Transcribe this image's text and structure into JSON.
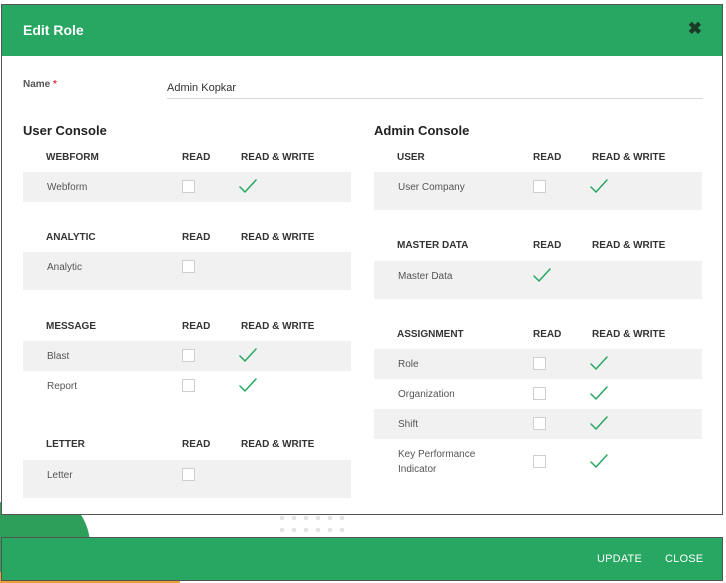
{
  "dialog": {
    "title": "Edit Role"
  },
  "name_field": {
    "label": "Name",
    "required_mark": "*",
    "value": "Admin Kopkar"
  },
  "user_console": {
    "title": "User Console",
    "sections": [
      {
        "header": "WEBFORM",
        "read_label": "READ",
        "rw_label": "READ & WRITE",
        "rows": [
          {
            "label": "Webform",
            "read": false,
            "rw": true
          }
        ]
      },
      {
        "header": "ANALYTIC",
        "read_label": "READ",
        "rw_label": "READ & WRITE",
        "rows": [
          {
            "label": "Analytic",
            "read": false,
            "rw": false
          }
        ]
      },
      {
        "header": "MESSAGE",
        "read_label": "READ",
        "rw_label": "READ & WRITE",
        "rows": [
          {
            "label": "Blast",
            "read": false,
            "rw": true
          },
          {
            "label": "Report",
            "read": false,
            "rw": true
          }
        ]
      },
      {
        "header": "LETTER",
        "read_label": "READ",
        "rw_label": "READ & WRITE",
        "rows": [
          {
            "label": "Letter",
            "read": false,
            "rw": false
          }
        ]
      }
    ]
  },
  "admin_console": {
    "title": "Admin Console",
    "sections": [
      {
        "header": "USER",
        "read_label": "READ",
        "rw_label": "READ & WRITE",
        "rows": [
          {
            "label": "User Company",
            "read": false,
            "rw": true
          }
        ]
      },
      {
        "header": "MASTER DATA",
        "read_label": "READ",
        "rw_label": "READ & WRITE",
        "rows": [
          {
            "label": "Master Data",
            "read": true,
            "rw": false
          }
        ]
      },
      {
        "header": "ASSIGNMENT",
        "read_label": "READ",
        "rw_label": "READ & WRITE",
        "rows": [
          {
            "label": "Role",
            "read": false,
            "rw": true
          },
          {
            "label": "Organization",
            "read": false,
            "rw": true
          },
          {
            "label": "Shift",
            "read": false,
            "rw": true
          },
          {
            "label": "Key Performance",
            "label2": "Indicator",
            "read": false,
            "rw": true
          }
        ]
      }
    ]
  },
  "footer": {
    "update_label": "UPDATE",
    "close_label": "CLOSE"
  },
  "colors": {
    "accent": "#27a761",
    "check": "#27a761",
    "row_shade": "#f1f1f1"
  },
  "icons": {
    "close": "close-icon",
    "check": "check-icon"
  }
}
